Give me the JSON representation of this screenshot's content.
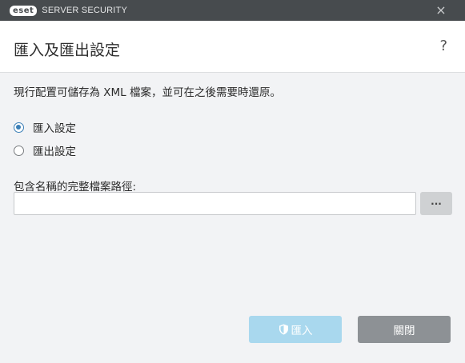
{
  "titlebar": {
    "logo_text": "eset",
    "app_name": "SERVER SECURITY",
    "close_icon": "×"
  },
  "header": {
    "title": "匯入及匯出設定",
    "help_icon": "?"
  },
  "main": {
    "description": "現行配置可儲存為 XML 檔案，並可在之後需要時還原。",
    "options": [
      {
        "label": "匯入設定",
        "selected": true
      },
      {
        "label": "匯出設定",
        "selected": false
      }
    ],
    "path_label": "包含名稱的完整檔案路徑:",
    "path_value": "",
    "browse_label": "..."
  },
  "footer": {
    "import_label": "匯入",
    "close_label": "關閉"
  },
  "colors": {
    "titlebar": "#474b4e",
    "accent": "#3b7fb6",
    "import_button": "#a9d8ee",
    "close_button": "#8d9195"
  }
}
